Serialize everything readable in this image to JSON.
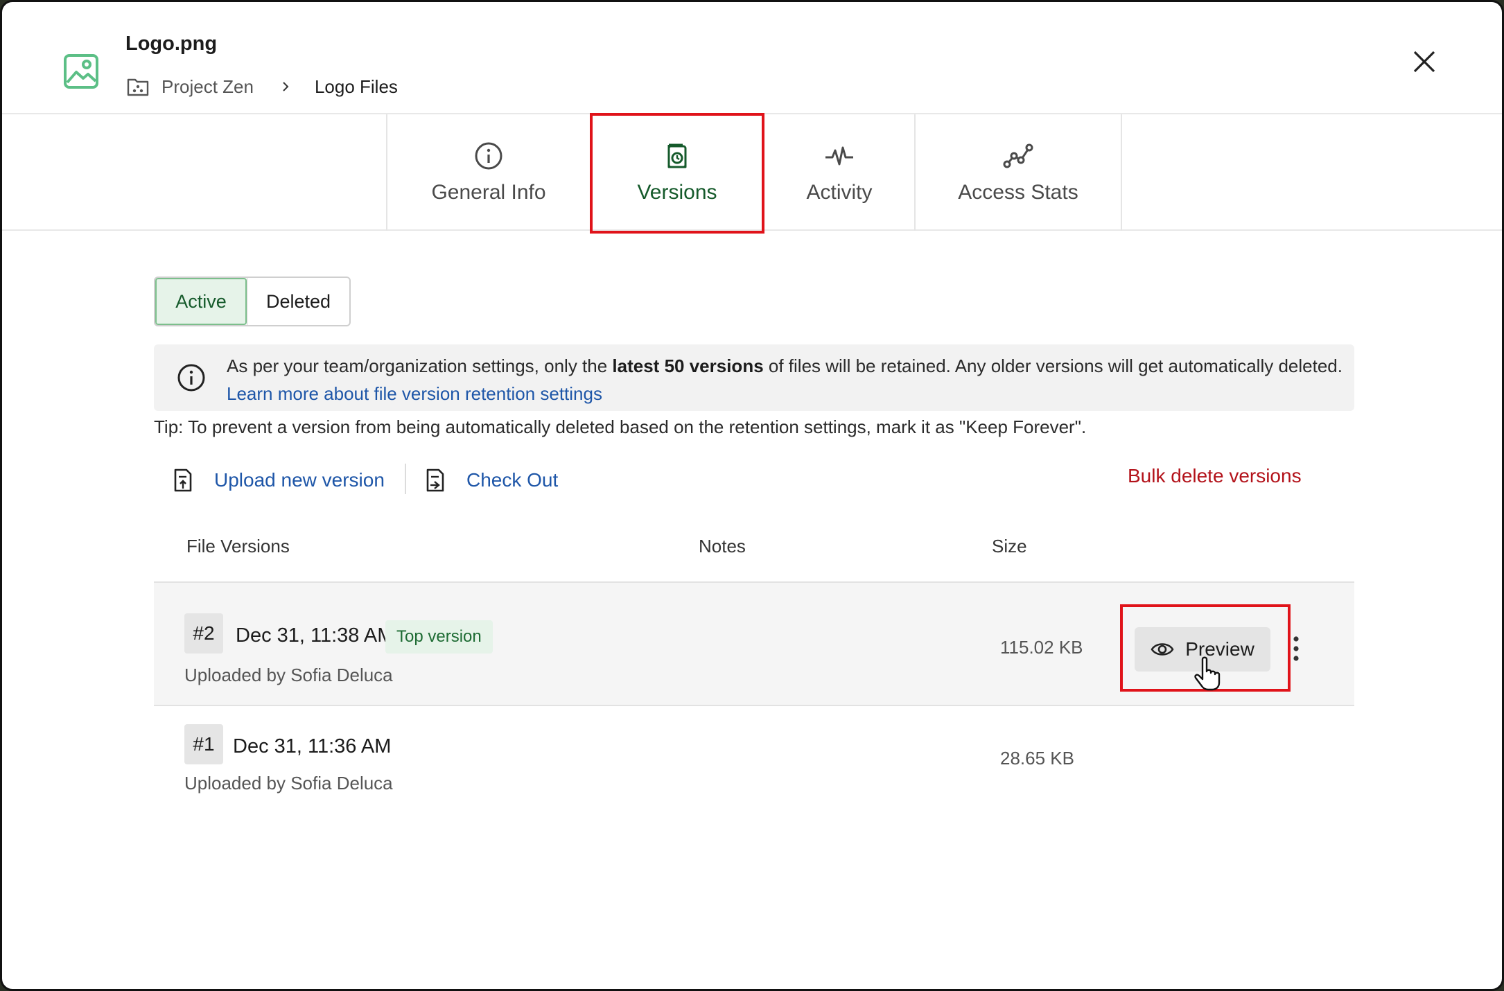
{
  "header": {
    "file_name": "Logo.png",
    "file_icon": "image-file-icon",
    "breadcrumb": {
      "project": "Project Zen",
      "folder": "Logo Files"
    },
    "close_icon": "close-icon"
  },
  "tabs": [
    {
      "label": "General Info",
      "icon": "info-circle-icon",
      "active": false
    },
    {
      "label": "Versions",
      "icon": "version-history-icon",
      "active": true
    },
    {
      "label": "Activity",
      "icon": "pulse-icon",
      "active": false
    },
    {
      "label": "Access Stats",
      "icon": "stats-graph-icon",
      "active": false
    }
  ],
  "filter": {
    "active_label": "Active",
    "deleted_label": "Deleted",
    "selected": "Active"
  },
  "retention_notice": {
    "text_before": "As per your team/organization settings, only the ",
    "text_bold": "latest 50 versions",
    "text_after": " of files will be retained. Any older versions will get automatically deleted. ",
    "link_text": "Learn more about file version retention settings"
  },
  "tip": "Tip: To prevent a version from being automatically deleted based on the retention settings, mark it as \"Keep Forever\".",
  "actions": {
    "upload_label": "Upload new version",
    "checkout_label": "Check Out",
    "bulk_delete_label": "Bulk delete versions"
  },
  "table": {
    "columns": [
      "File Versions",
      "Notes",
      "Size"
    ],
    "rows": [
      {
        "version": "#2",
        "date": "Dec 31, 11:38 AM",
        "badge": "Top version",
        "uploaded_by": "Uploaded by Sofia Deluca",
        "notes": "",
        "size": "115.02 KB",
        "preview_label": "Preview"
      },
      {
        "version": "#1",
        "date": "Dec 31, 11:36 AM",
        "badge": "",
        "uploaded_by": "Uploaded by Sofia Deluca",
        "notes": "",
        "size": "28.65 KB"
      }
    ]
  },
  "colors": {
    "accent_green": "#155a2b",
    "link_blue": "#1e56a8",
    "danger_red": "#b3121a",
    "highlight_red": "#e0131a"
  }
}
